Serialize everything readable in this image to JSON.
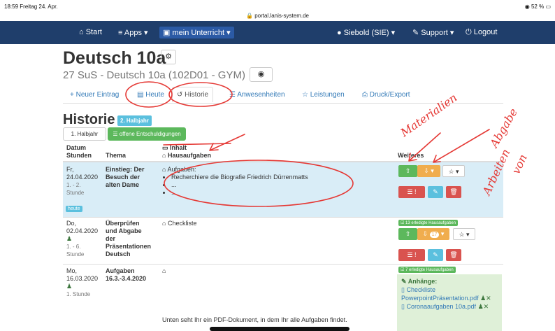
{
  "statusbar": {
    "time": "18:59",
    "date": "Freitag 24. Apr.",
    "url": "portal.lanis-system.de",
    "battery": "52 %"
  },
  "navbar": {
    "start": "Start",
    "apps": "Apps",
    "mein": "mein Unterricht",
    "user": "Siebold (SIE)",
    "support": "Support",
    "logout": "Logout"
  },
  "course": {
    "title": "Deutsch 10a",
    "subtitle": "27 SuS - Deutsch 10a (102D01 - GYM)"
  },
  "tabs": {
    "neu": "Neuer Eintrag",
    "heute": "Heute",
    "historie": "Historie",
    "anw": "Anwesenheiten",
    "leist": "Leistungen",
    "druck": "Druck/Export"
  },
  "historie": {
    "title": "Historie",
    "badge": "2. Halbjahr",
    "btn_halb": "1. Halbjahr",
    "btn_offen": "offene Entschuldigungen"
  },
  "headers": {
    "datum": "Datum",
    "stunden": "Stunden",
    "thema": "Thema",
    "inhalt": "Inhalt",
    "hausaufgaben": "Hausaufgaben",
    "weiteres": "Weiteres"
  },
  "rows": [
    {
      "day": "Fr,",
      "date": "24.04.2020",
      "hours": "1. - 2.",
      "unit": "Stunde",
      "theme": [
        "Einstieg: Der",
        "Besuch der",
        "alten Dame"
      ],
      "hw_label": "Aufgaben:",
      "items": [
        "Recherchiere die Biografie Friedrich Dürrenmatts",
        "...",
        "..."
      ],
      "tag": "heute"
    },
    {
      "day": "Do,",
      "date": "02.04.2020",
      "hours": "1. - 6.",
      "unit": "Stunde",
      "theme": [
        "Überprüfen",
        "und Abgabe",
        "der",
        "Präsentationen",
        "Deutsch"
      ],
      "inhalt": "Checkliste",
      "done": "13 erledigte Hausaufgaben",
      "count": "17"
    },
    {
      "day": "Mo,",
      "date": "16.03.2020",
      "hours": "1. Stunde",
      "theme": [
        "Aufgaben",
        "16.3.-3.4.2020"
      ],
      "done": "7 erledigte Hausaufgaben",
      "note": "Unten seht Ihr ein PDF-Dokument, in dem Ihr alle Aufgaben findet.",
      "anhaenge": "Anhänge:",
      "file1": "Checkliste PowerpointPräsentation.pdf",
      "file2": "Coronaaufgaben 10a.pdf"
    }
  ],
  "annotations": {
    "materialien": "Materialien",
    "abgabe": "Abgabe",
    "von": "von",
    "arbeiten": "Arbeiten"
  }
}
